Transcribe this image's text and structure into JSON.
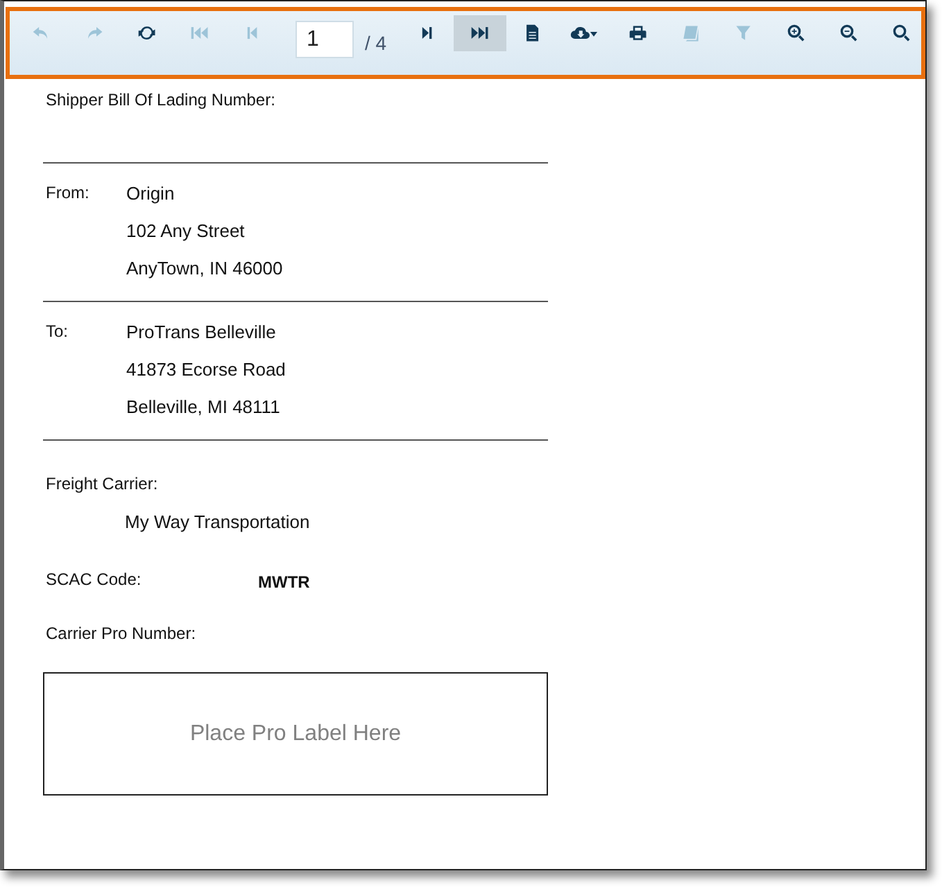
{
  "toolbar": {
    "items": [
      {
        "kind": "undo",
        "disabled": true,
        "selected": false
      },
      {
        "kind": "redo",
        "disabled": true,
        "selected": false
      },
      {
        "kind": "refresh",
        "disabled": false,
        "selected": false
      },
      {
        "kind": "first",
        "disabled": true,
        "selected": false
      },
      {
        "kind": "prev",
        "disabled": true,
        "selected": false
      },
      {
        "kind": "page-field",
        "value": "1",
        "total": "/ 4"
      },
      {
        "kind": "next",
        "disabled": false,
        "selected": false
      },
      {
        "kind": "last",
        "disabled": false,
        "selected": true
      },
      {
        "kind": "document",
        "disabled": false,
        "selected": false
      },
      {
        "kind": "export",
        "disabled": false,
        "selected": false
      },
      {
        "kind": "print",
        "disabled": false,
        "selected": false
      },
      {
        "kind": "book",
        "disabled": true,
        "selected": false
      },
      {
        "kind": "filter",
        "disabled": true,
        "selected": false
      },
      {
        "kind": "zoom-in",
        "disabled": false,
        "selected": false
      },
      {
        "kind": "zoom-out",
        "disabled": false,
        "selected": false
      },
      {
        "kind": "search",
        "disabled": false,
        "selected": false
      }
    ]
  },
  "report": {
    "shipper_bol": {
      "label": "Shipper Bill Of Lading Number:"
    },
    "from": {
      "label": "From:",
      "lines": [
        "Origin",
        "102 Any Street",
        "AnyTown, IN 46000"
      ]
    },
    "to": {
      "label": "To:",
      "lines": [
        "ProTrans Belleville",
        "41873 Ecorse Road",
        "Belleville, MI 48111"
      ]
    },
    "freight_carrier": {
      "label": "Freight Carrier:",
      "value": "My Way Transportation"
    },
    "scac": {
      "label": "SCAC Code:",
      "value": "MWTR"
    },
    "carrier_pro": {
      "label": "Carrier Pro Number:"
    },
    "label_box": {
      "text": "Place Pro Label Here"
    }
  }
}
